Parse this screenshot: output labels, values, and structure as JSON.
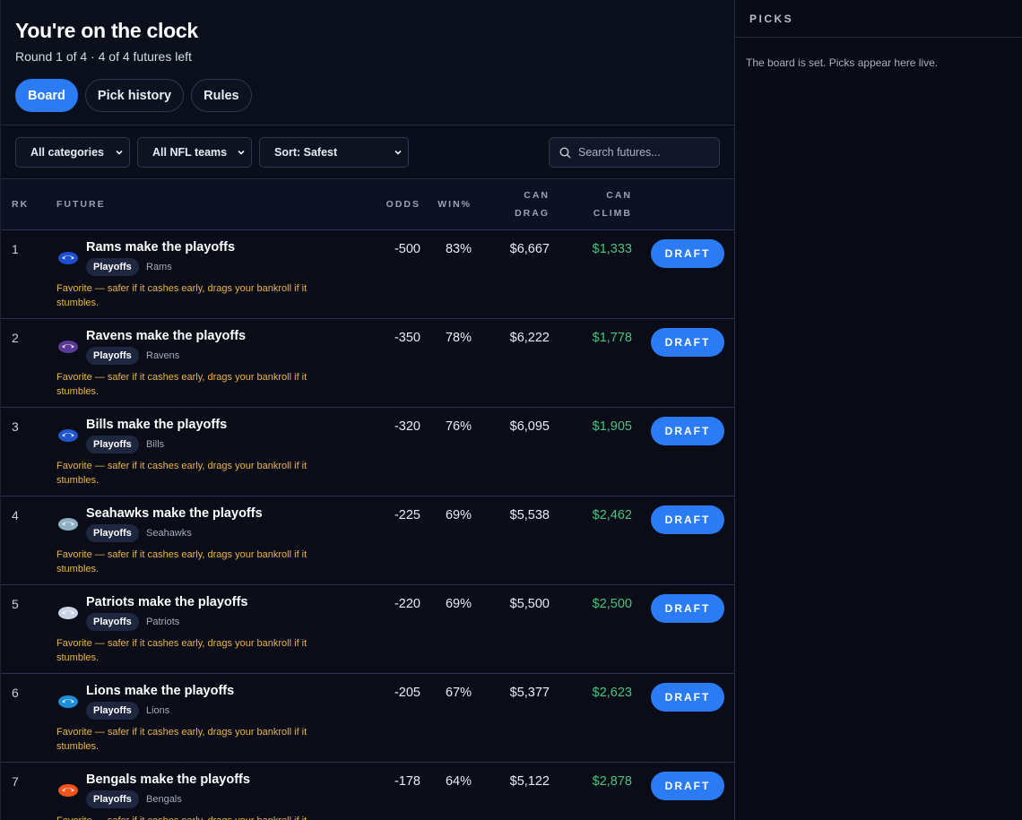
{
  "header": {
    "title": "You're on the clock",
    "subtitle": "Round 1 of 4 · 4 of 4 futures left",
    "tabs": [
      {
        "label": "Board",
        "active": true
      },
      {
        "label": "Pick history",
        "active": false
      },
      {
        "label": "Rules",
        "active": false
      }
    ]
  },
  "filters": {
    "category": "All categories",
    "team": "All NFL teams",
    "sort": "Sort: Safest",
    "search_placeholder": "Search futures..."
  },
  "table": {
    "columns": {
      "rk": "RK",
      "future": "FUTURE",
      "odds": "ODDS",
      "win": "WIN%",
      "drag_1": "CAN",
      "drag_2": "DRAG",
      "climb_1": "CAN",
      "climb_2": "CLIMB"
    },
    "draft_label": "DRAFT",
    "rows": [
      {
        "rank": "1",
        "future": "Rams make the playoffs",
        "category": "Playoffs",
        "team": "Rams",
        "note": "Favorite — safer if it cashes early, drags your bankroll if it stumbles.",
        "odds": "-500",
        "win": "83%",
        "drag": "$6,667",
        "climb": "$1,333",
        "logo": "rams-logo-icon",
        "color": "#1e4fd0"
      },
      {
        "rank": "2",
        "future": "Ravens make the playoffs",
        "category": "Playoffs",
        "team": "Ravens",
        "note": "Favorite — safer if it cashes early, drags your bankroll if it stumbles.",
        "odds": "-350",
        "win": "78%",
        "drag": "$6,222",
        "climb": "$1,778",
        "logo": "ravens-logo-icon",
        "color": "#5a3a96"
      },
      {
        "rank": "3",
        "future": "Bills make the playoffs",
        "category": "Playoffs",
        "team": "Bills",
        "note": "Favorite — safer if it cashes early, drags your bankroll if it stumbles.",
        "odds": "-320",
        "win": "76%",
        "drag": "$6,095",
        "climb": "$1,905",
        "logo": "bills-logo-icon",
        "color": "#1f56c9"
      },
      {
        "rank": "4",
        "future": "Seahawks make the playoffs",
        "category": "Playoffs",
        "team": "Seahawks",
        "note": "Favorite — safer if it cashes early, drags your bankroll if it stumbles.",
        "odds": "-225",
        "win": "69%",
        "drag": "$5,538",
        "climb": "$2,462",
        "logo": "seahawks-logo-icon",
        "color": "#8fb0c2"
      },
      {
        "rank": "5",
        "future": "Patriots make the playoffs",
        "category": "Playoffs",
        "team": "Patriots",
        "note": "Favorite — safer if it cashes early, drags your bankroll if it stumbles.",
        "odds": "-220",
        "win": "69%",
        "drag": "$5,500",
        "climb": "$2,500",
        "logo": "patriots-logo-icon",
        "color": "#c8d4e6"
      },
      {
        "rank": "6",
        "future": "Lions make the playoffs",
        "category": "Playoffs",
        "team": "Lions",
        "note": "Favorite — safer if it cashes early, drags your bankroll if it stumbles.",
        "odds": "-205",
        "win": "67%",
        "drag": "$5,377",
        "climb": "$2,623",
        "logo": "lions-logo-icon",
        "color": "#1e8fd6"
      },
      {
        "rank": "7",
        "future": "Bengals make the playoffs",
        "category": "Playoffs",
        "team": "Bengals",
        "note": "Favorite — safer if it cashes early, drags your bankroll if it stumbles.",
        "odds": "-178",
        "win": "64%",
        "drag": "$5,122",
        "climb": "$2,878",
        "logo": "bengals-logo-icon",
        "color": "#f0531c"
      }
    ]
  },
  "picks": {
    "title": "PICKS",
    "empty_message": "The board is set. Picks appear here live."
  },
  "colors": {
    "accent": "#2b7bf5",
    "positive": "#45c47c",
    "warning": "#e9b448"
  }
}
